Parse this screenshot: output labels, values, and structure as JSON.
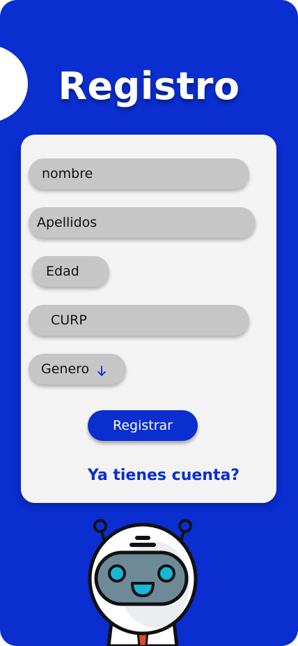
{
  "colors": {
    "background": "#0a2ecf",
    "card": "#f3f3f4",
    "field": "#c6c6c6",
    "accent": "#0a2ecf"
  },
  "header": {
    "title": "Registro"
  },
  "form": {
    "fields": {
      "nombre": "nombre",
      "apellidos": "Apellidos",
      "edad": "Edad",
      "curp": "CURP",
      "genero": "Genero"
    },
    "genero_icon": "arrow-down-icon",
    "submit_label": "Registrar",
    "login_link": "Ya tienes cuenta?"
  },
  "illustration": {
    "icon": "robot-mascot-icon"
  }
}
